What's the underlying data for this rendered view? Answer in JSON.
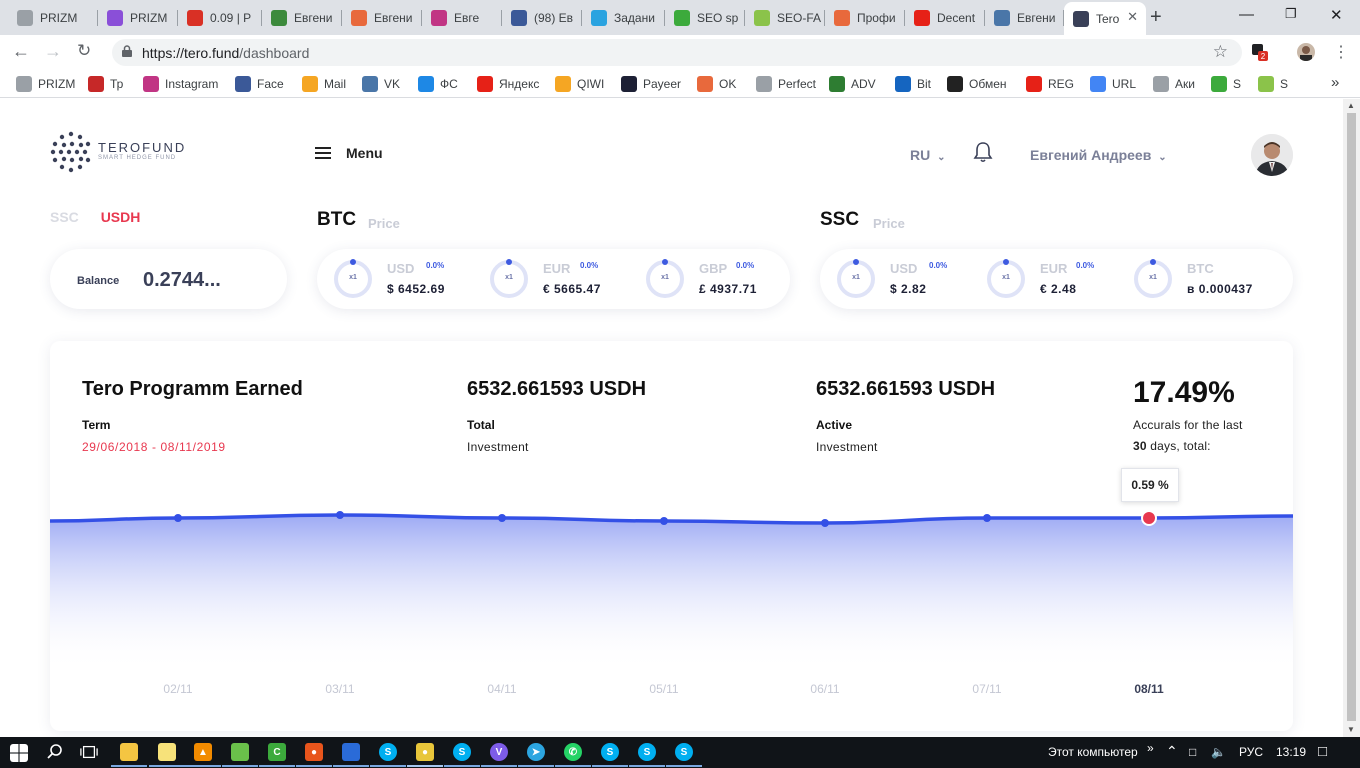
{
  "browser": {
    "tabs": [
      {
        "label": "PRIZM",
        "icon": "page-icon",
        "color": "#9aa0a6"
      },
      {
        "label": "PRIZM",
        "icon": "prizm-icon",
        "color": "#8a4fd8"
      },
      {
        "label": "0.09 | P",
        "icon": "exchange-icon",
        "color": "#d93025"
      },
      {
        "label": "Евгени",
        "icon": "n-icon",
        "color": "#3c8a3c"
      },
      {
        "label": "Евгени",
        "icon": "ok-icon",
        "color": "#e8693c"
      },
      {
        "label": "Евге",
        "icon": "instagram-icon",
        "color": "#c13584"
      },
      {
        "label": "(98) Ев",
        "icon": "facebook-icon",
        "color": "#3b5998"
      },
      {
        "label": "Задани",
        "icon": "task-icon",
        "color": "#2aa3e0"
      },
      {
        "label": "SEO sp",
        "icon": "seo-icon",
        "color": "#3caa3c"
      },
      {
        "label": "SEO-FA",
        "icon": "sf-icon",
        "color": "#8bc34a"
      },
      {
        "label": "Профи",
        "icon": "k-icon",
        "color": "#e8693c"
      },
      {
        "label": "Decent",
        "icon": "youtube-icon",
        "color": "#e62117"
      },
      {
        "label": "Евгени",
        "icon": "vk-icon",
        "color": "#4a76a8"
      },
      {
        "label": "Tero",
        "icon": "tero-icon",
        "color": "#3a4058"
      }
    ],
    "url_domain": "https://tero.fund",
    "url_path": "/dashboard",
    "bookmarks": [
      {
        "label": "PRIZM",
        "icon": "page-icon",
        "color": "#9aa0a6"
      },
      {
        "label": "Тр",
        "icon": "star-icon",
        "color": "#c62828"
      },
      {
        "label": "Instagram",
        "icon": "instagram-icon",
        "color": "#c13584"
      },
      {
        "label": "Face",
        "icon": "facebook-icon",
        "color": "#3b5998"
      },
      {
        "label": "Mail",
        "icon": "mail-icon",
        "color": "#f5a623"
      },
      {
        "label": "VK",
        "icon": "vk-icon",
        "color": "#4a76a8"
      },
      {
        "label": "ФС",
        "icon": "fs-icon",
        "color": "#1e88e5"
      },
      {
        "label": "Яндекс",
        "icon": "yandex-icon",
        "color": "#e62117"
      },
      {
        "label": "QIWI",
        "icon": "qiwi-icon",
        "color": "#f5a623"
      },
      {
        "label": "Payeer",
        "icon": "payeer-icon",
        "color": "#1d2035"
      },
      {
        "label": "OK",
        "icon": "ok-icon",
        "color": "#e8693c"
      },
      {
        "label": "Perfect",
        "icon": "page-icon",
        "color": "#9aa0a6"
      },
      {
        "label": "ADV",
        "icon": "adv-icon",
        "color": "#2e7d32"
      },
      {
        "label": "Bit",
        "icon": "bit-icon",
        "color": "#1565c0"
      },
      {
        "label": "Обмен",
        "icon": "bc-icon",
        "color": "#222222"
      },
      {
        "label": "REG",
        "icon": "reg-icon",
        "color": "#e62117"
      },
      {
        "label": "URL",
        "icon": "google-icon",
        "color": "#4285f4"
      },
      {
        "label": "Аки",
        "icon": "page-icon",
        "color": "#9aa0a6"
      },
      {
        "label": "S",
        "icon": "seo-icon",
        "color": "#3caa3c"
      },
      {
        "label": "S",
        "icon": "sf-icon",
        "color": "#8bc34a"
      }
    ],
    "bookmarks_more": "»",
    "extension_badge": "2"
  },
  "header": {
    "logo_name": "TEROFUND",
    "logo_tagline": "SMART HEDGE FUND",
    "menu_label": "Menu",
    "language": "RU",
    "user_name": "Евгений Андреев"
  },
  "balance": {
    "tabs": [
      "SSC",
      "USDH"
    ],
    "active_tab": "USDH",
    "label": "Balance",
    "value": "0.2744..."
  },
  "btc_panel": {
    "title": "BTC",
    "subtitle": "Price",
    "items": [
      {
        "multiplier": "x1",
        "currency": "USD",
        "change": "0.0%",
        "value": "$ 6452.69"
      },
      {
        "multiplier": "x1",
        "currency": "EUR",
        "change": "0.0%",
        "value": "€ 5665.47"
      },
      {
        "multiplier": "x1",
        "currency": "GBP",
        "change": "0.0%",
        "value": "£ 4937.71"
      }
    ]
  },
  "ssc_panel": {
    "title": "SSC",
    "subtitle": "Price",
    "items": [
      {
        "multiplier": "x1",
        "currency": "USD",
        "change": "0.0%",
        "value": "$ 2.82"
      },
      {
        "multiplier": "x1",
        "currency": "EUR",
        "change": "0.0%",
        "value": "€ 2.48"
      },
      {
        "multiplier": "x1",
        "currency": "BTC",
        "change": "",
        "value": "в 0.000437"
      }
    ]
  },
  "program": {
    "title": "Tero Programm Earned",
    "term_label": "Term",
    "term_value": "29/06/2018 - 08/11/2019",
    "total_amount": "6532.661593 USDH",
    "total_label": "Total",
    "total_sub": "Investment",
    "active_amount": "6532.661593 USDH",
    "active_label": "Active",
    "active_sub": "Investment",
    "percent": "17.49%",
    "accruals_line1": "Accurals for the last",
    "accruals_days": "30",
    "accruals_line2": " days, total:",
    "tooltip_value": "0.59 %"
  },
  "chart_data": {
    "type": "area",
    "x": [
      "02/11",
      "03/11",
      "04/11",
      "05/11",
      "06/11",
      "07/11",
      "08/11"
    ],
    "highlighted": "08/11",
    "accent_color": "#3450e6",
    "highlight_color": "#e8384f"
  },
  "taskbar": {
    "computer_label": "Этот компьютер",
    "lang": "РУС",
    "time": "13:19"
  }
}
